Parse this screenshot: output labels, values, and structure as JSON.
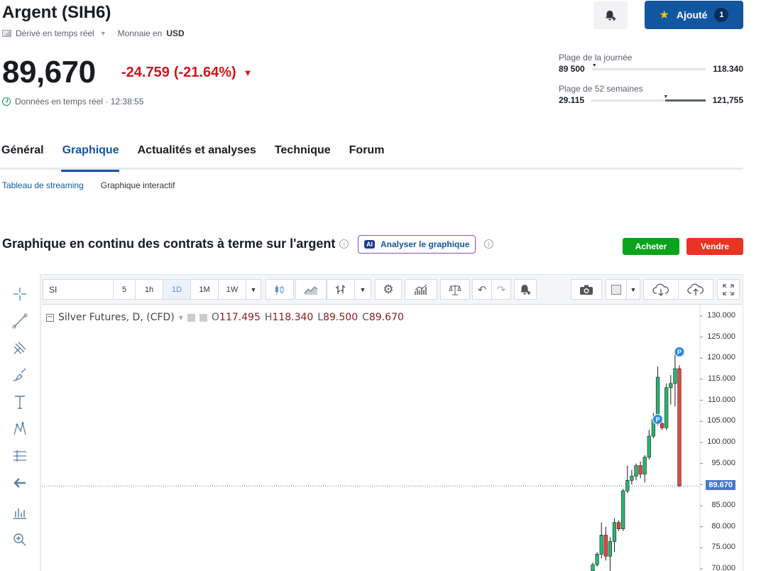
{
  "header": {
    "title": "Argent (SIH6)",
    "derivative": "Dérivé en temps réel",
    "currency_label": "Monnaie en",
    "currency": "USD",
    "added_label": "Ajouté",
    "added_count": "1"
  },
  "quote": {
    "price": "89,670",
    "change": "-24.759",
    "change_pct": "(-21.64%)",
    "realtime": "Données en temps réel · 12:38:55",
    "down_color": "#d0161b"
  },
  "ranges": {
    "day_label": "Plage de la journée",
    "day_low": "89 500",
    "day_high": "118.340",
    "day_marker_fraction": 0.0,
    "week52_label": "Plage de 52 semaines",
    "week52_low": "29.115",
    "week52_high": "121,755",
    "week52_marker_fraction": 0.65
  },
  "tabs": [
    "Général",
    "Graphique",
    "Actualités et analyses",
    "Technique",
    "Forum"
  ],
  "active_tab": "Graphique",
  "subtabs": [
    "Tableau de streaming",
    "Graphique interactif"
  ],
  "section": {
    "title": "Graphique en continu des contrats à terme sur l'argent",
    "analyze": "Analyser le graphique",
    "ai_badge": "AI",
    "buy": "Acheter",
    "sell": "Vendre"
  },
  "toolbar": {
    "symbol": "SI",
    "intervals": [
      "5",
      "1h",
      "1D",
      "1M",
      "1W"
    ],
    "selected_interval": "1D"
  },
  "legend": {
    "name": "Silver Futures, D, (CFD)",
    "o_label": "O",
    "o": "117.495",
    "h_label": "H",
    "h": "118.340",
    "l_label": "L",
    "l": "89.500",
    "c_label": "C",
    "c": "89.670"
  },
  "chart_data": {
    "type": "candlestick",
    "y_ticks": [
      "130.000",
      "125.000",
      "120.000",
      "115.000",
      "110.000",
      "105.000",
      "100.000",
      "95.000",
      "90.000",
      "85.000",
      "80.000",
      "75.000",
      "70.000"
    ],
    "ylim": [
      70,
      130
    ],
    "last_price": "89.670",
    "last_price_value": 89.67,
    "up_color": "#2bb673",
    "down_color": "#e2483d",
    "candles": [
      {
        "o": 69.5,
        "h": 71.5,
        "l": 69.0,
        "c": 71.0
      },
      {
        "o": 71.0,
        "h": 74.0,
        "l": 70.5,
        "c": 73.5
      },
      {
        "o": 73.5,
        "h": 81.0,
        "l": 72.5,
        "c": 78.0
      },
      {
        "o": 78.0,
        "h": 80.0,
        "l": 72.0,
        "c": 73.0
      },
      {
        "o": 73.0,
        "h": 77.5,
        "l": 69.5,
        "c": 76.5
      },
      {
        "o": 76.5,
        "h": 82.0,
        "l": 74.0,
        "c": 81.0
      },
      {
        "o": 81.0,
        "h": 81.5,
        "l": 79.0,
        "c": 79.5
      },
      {
        "o": 79.5,
        "h": 89.0,
        "l": 79.0,
        "c": 88.5
      },
      {
        "o": 88.5,
        "h": 94.5,
        "l": 88.0,
        "c": 91.0
      },
      {
        "o": 91.0,
        "h": 93.5,
        "l": 90.0,
        "c": 92.0
      },
      {
        "o": 92.0,
        "h": 95.0,
        "l": 91.0,
        "c": 94.5
      },
      {
        "o": 94.5,
        "h": 95.5,
        "l": 91.5,
        "c": 92.5
      },
      {
        "o": 92.5,
        "h": 97.0,
        "l": 90.5,
        "c": 96.5
      },
      {
        "o": 96.5,
        "h": 103.0,
        "l": 96.0,
        "c": 101.5
      },
      {
        "o": 101.5,
        "h": 107.0,
        "l": 101.0,
        "c": 105.5
      },
      {
        "o": 105.5,
        "h": 118.0,
        "l": 104.0,
        "c": 115.5
      },
      {
        "o": 104.5,
        "h": 106.0,
        "l": 103.0,
        "c": 103.5
      },
      {
        "o": 103.5,
        "h": 114.0,
        "l": 103.0,
        "c": 113.0
      },
      {
        "o": 113.0,
        "h": 116.0,
        "l": 109.0,
        "c": 114.0
      },
      {
        "o": 114.0,
        "h": 121.0,
        "l": 108.5,
        "c": 117.5
      },
      {
        "o": 117.5,
        "h": 118.3,
        "l": 89.5,
        "c": 89.67
      }
    ],
    "markers": [
      {
        "label": "P",
        "candle_index": 15,
        "y": 105.5
      },
      {
        "label": "P",
        "candle_index": 20,
        "y": 121.5
      }
    ]
  }
}
